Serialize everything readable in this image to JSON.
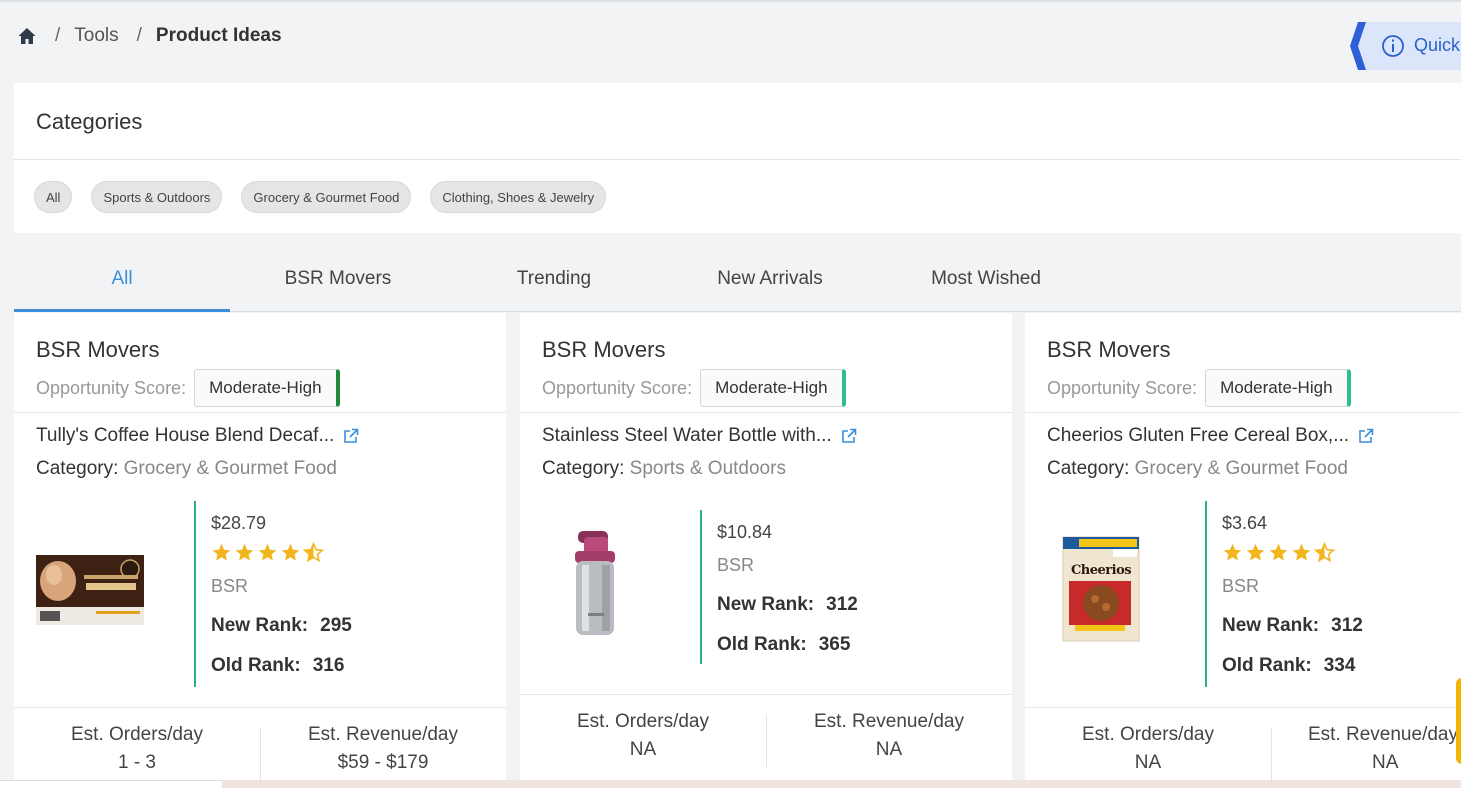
{
  "breadcrumb": {
    "items": [
      "Tools",
      "Product Ideas"
    ]
  },
  "quick_tab": {
    "label": "Quick",
    "color": "#2a62c9"
  },
  "categories": {
    "title": "Categories",
    "chips": [
      "All",
      "Sports & Outdoors",
      "Grocery & Gourmet Food",
      "Clothing, Shoes & Jewelry"
    ]
  },
  "tabs": [
    {
      "label": "All",
      "active": true
    },
    {
      "label": "BSR Movers"
    },
    {
      "label": "Trending"
    },
    {
      "label": "New Arrivals"
    },
    {
      "label": "Most Wished"
    }
  ],
  "labels": {
    "opportunity_score": "Opportunity Score:",
    "category": "Category:",
    "bsr": "BSR",
    "new_rank": "New Rank:",
    "old_rank": "Old Rank:",
    "orders": "Est. Orders/day",
    "revenue": "Est. Revenue/day"
  },
  "cards": [
    {
      "type": "BSR Movers",
      "score": "Moderate-High",
      "score_color": "#1e8a3a",
      "title": "Tully's Coffee House Blend Decaf...",
      "category": "Grocery & Gourmet Food",
      "price": "$28.79",
      "rating": 4.5,
      "new_rank": "295",
      "old_rank": "316",
      "orders": "1 - 3",
      "revenue": "$59 - $179",
      "image": "coffee-box"
    },
    {
      "type": "BSR Movers",
      "score": "Moderate-High",
      "score_color": "#2ec08a",
      "title": "Stainless Steel Water Bottle with...",
      "category": "Sports & Outdoors",
      "price": "$10.84",
      "rating": 0,
      "new_rank": "312",
      "old_rank": "365",
      "orders": "NA",
      "revenue": "NA",
      "image": "water-bottle"
    },
    {
      "type": "BSR Movers",
      "score": "Moderate-High",
      "score_color": "#2ec08a",
      "title": "Cheerios Gluten Free Cereal Box,...",
      "category": "Grocery & Gourmet Food",
      "price": "$3.64",
      "rating": 4.5,
      "new_rank": "312",
      "old_rank": "334",
      "orders": "NA",
      "revenue": "NA",
      "image": "cereal-box",
      "box_text": "Cheerios"
    }
  ]
}
